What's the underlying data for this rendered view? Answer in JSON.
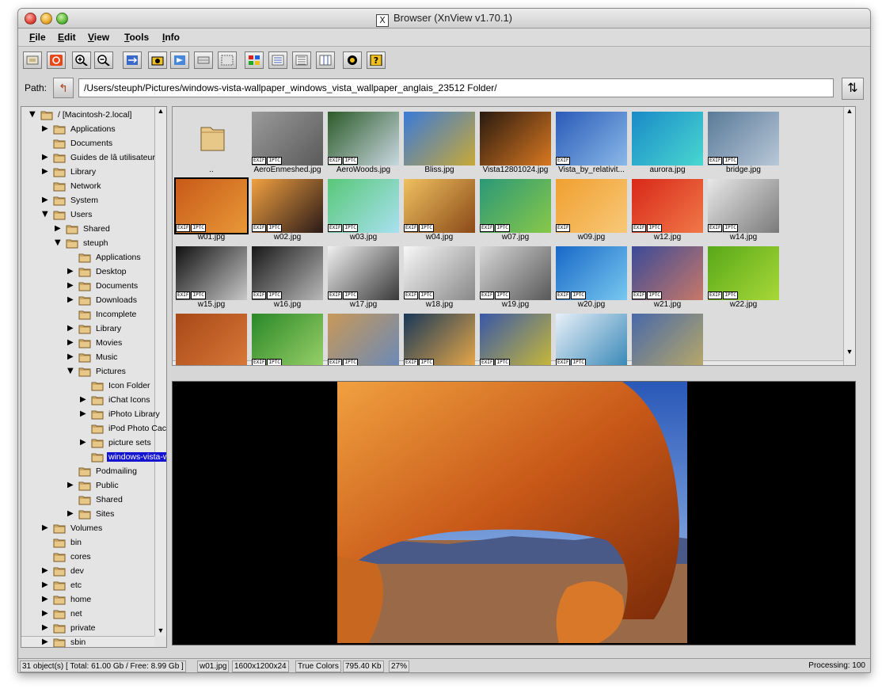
{
  "window": {
    "title": "Browser (XnView v1.70.1)"
  },
  "menu": [
    "File",
    "Edit",
    "View",
    "Tools",
    "Info"
  ],
  "path": {
    "label": "Path:",
    "value": "/Users/steuph/Pictures/windows-vista-wallpaper_windows_vista_wallpaper_anglais_23512 Folder/"
  },
  "tree": [
    {
      "label": "/ [Macintosh-2.local]",
      "depth": 0,
      "arrow": "open"
    },
    {
      "label": "Applications",
      "depth": 1,
      "arrow": "closed"
    },
    {
      "label": "Documents",
      "depth": 1,
      "arrow": "none"
    },
    {
      "label": "Guides de lâ utilisateur",
      "depth": 1,
      "arrow": "closed"
    },
    {
      "label": "Library",
      "depth": 1,
      "arrow": "closed"
    },
    {
      "label": "Network",
      "depth": 1,
      "arrow": "none"
    },
    {
      "label": "System",
      "depth": 1,
      "arrow": "closed"
    },
    {
      "label": "Users",
      "depth": 1,
      "arrow": "open"
    },
    {
      "label": "Shared",
      "depth": 2,
      "arrow": "closed"
    },
    {
      "label": "steuph",
      "depth": 2,
      "arrow": "open"
    },
    {
      "label": "Applications",
      "depth": 3,
      "arrow": "none"
    },
    {
      "label": "Desktop",
      "depth": 3,
      "arrow": "closed"
    },
    {
      "label": "Documents",
      "depth": 3,
      "arrow": "closed"
    },
    {
      "label": "Downloads",
      "depth": 3,
      "arrow": "closed"
    },
    {
      "label": "Incomplete",
      "depth": 3,
      "arrow": "none"
    },
    {
      "label": "Library",
      "depth": 3,
      "arrow": "closed"
    },
    {
      "label": "Movies",
      "depth": 3,
      "arrow": "closed"
    },
    {
      "label": "Music",
      "depth": 3,
      "arrow": "closed"
    },
    {
      "label": "Pictures",
      "depth": 3,
      "arrow": "open"
    },
    {
      "label": "Icon Folder",
      "depth": 4,
      "arrow": "none"
    },
    {
      "label": "iChat Icons",
      "depth": 4,
      "arrow": "closed"
    },
    {
      "label": "iPhoto Library",
      "depth": 4,
      "arrow": "closed"
    },
    {
      "label": "iPod Photo Cach",
      "depth": 4,
      "arrow": "none"
    },
    {
      "label": "picture sets",
      "depth": 4,
      "arrow": "closed"
    },
    {
      "label": "windows-vista-w",
      "depth": 4,
      "arrow": "none",
      "selected": true
    },
    {
      "label": "Podmailing",
      "depth": 3,
      "arrow": "none"
    },
    {
      "label": "Public",
      "depth": 3,
      "arrow": "closed"
    },
    {
      "label": "Shared",
      "depth": 3,
      "arrow": "none"
    },
    {
      "label": "Sites",
      "depth": 3,
      "arrow": "closed"
    },
    {
      "label": "Volumes",
      "depth": 1,
      "arrow": "closed"
    },
    {
      "label": "bin",
      "depth": 1,
      "arrow": "none"
    },
    {
      "label": "cores",
      "depth": 1,
      "arrow": "none"
    },
    {
      "label": "dev",
      "depth": 1,
      "arrow": "closed"
    },
    {
      "label": "etc",
      "depth": 1,
      "arrow": "closed"
    },
    {
      "label": "home",
      "depth": 1,
      "arrow": "closed"
    },
    {
      "label": "net",
      "depth": 1,
      "arrow": "closed"
    },
    {
      "label": "private",
      "depth": 1,
      "arrow": "closed"
    },
    {
      "label": "sbin",
      "depth": 1,
      "arrow": "closed"
    }
  ],
  "thumbnails": [
    {
      "name": "..",
      "kind": "folder"
    },
    {
      "name": "AeroEnmeshed.jpg",
      "colors": [
        "#9a9a9a",
        "#5a5a5a"
      ],
      "badges": [
        "EXIF",
        "IPTC"
      ]
    },
    {
      "name": "AeroWoods.jpg",
      "colors": [
        "#2d5a2a",
        "#c8d8e0"
      ],
      "badges": [
        "EXIF",
        "IPTC"
      ]
    },
    {
      "name": "Bliss.jpg",
      "colors": [
        "#3a7ad8",
        "#c8a838"
      ],
      "badges": []
    },
    {
      "name": "Vista12801024.jpg",
      "colors": [
        "#2a1a10",
        "#d87820"
      ],
      "badges": []
    },
    {
      "name": "Vista_by_relativit...",
      "colors": [
        "#2a5ab8",
        "#8ab8e8"
      ],
      "badges": [
        "EXIF"
      ]
    },
    {
      "name": "aurora.jpg",
      "colors": [
        "#1a8ac8",
        "#48d8d0"
      ],
      "badges": []
    },
    {
      "name": "bridge.jpg",
      "colors": [
        "#5a7a98",
        "#b8c8d8"
      ],
      "badges": [
        "EXIF",
        "IPTC"
      ]
    },
    {
      "name": "w01.jpg",
      "colors": [
        "#c85a18",
        "#e89838"
      ],
      "badges": [
        "EXIF",
        "IPTC"
      ],
      "selected": true
    },
    {
      "name": "w02.jpg",
      "colors": [
        "#f0a040",
        "#2a1a18"
      ],
      "badges": [
        "EXIF",
        "IPTC"
      ]
    },
    {
      "name": "w03.jpg",
      "colors": [
        "#58c878",
        "#a8e0f0"
      ],
      "badges": [
        "EXIF",
        "IPTC"
      ]
    },
    {
      "name": "w04.jpg",
      "colors": [
        "#f0c060",
        "#8a4a18"
      ],
      "badges": [
        "EXIF",
        "IPTC"
      ]
    },
    {
      "name": "w07.jpg",
      "colors": [
        "#2a9878",
        "#88c848"
      ],
      "badges": [
        "EXIF",
        "IPTC"
      ]
    },
    {
      "name": "w09.jpg",
      "colors": [
        "#f0a030",
        "#f8c878"
      ],
      "badges": [
        "EXIF"
      ]
    },
    {
      "name": "w12.jpg",
      "colors": [
        "#d82818",
        "#f07848"
      ],
      "badges": [
        "EXIF",
        "IPTC"
      ]
    },
    {
      "name": "w14.jpg",
      "colors": [
        "#e8e8e8",
        "#7a7a7a"
      ],
      "badges": [
        "EXIF",
        "IPTC"
      ]
    },
    {
      "name": "w15.jpg",
      "colors": [
        "#101010",
        "#c8c8c8"
      ],
      "badges": [
        "EXIF",
        "IPTC"
      ]
    },
    {
      "name": "w16.jpg",
      "colors": [
        "#181818",
        "#b8b8b8"
      ],
      "badges": [
        "EXIF",
        "IPTC"
      ]
    },
    {
      "name": "w17.jpg",
      "colors": [
        "#f0f0f0",
        "#383838"
      ],
      "badges": [
        "EXIF",
        "IPTC"
      ]
    },
    {
      "name": "w18.jpg",
      "colors": [
        "#f8f8f8",
        "#888888"
      ],
      "badges": [
        "EXIF",
        "IPTC"
      ]
    },
    {
      "name": "w19.jpg",
      "colors": [
        "#d8d8d8",
        "#585858"
      ],
      "badges": [
        "EXIF",
        "IPTC"
      ]
    },
    {
      "name": "w20.jpg",
      "colors": [
        "#1868c8",
        "#78c8f0"
      ],
      "badges": [
        "EXIF",
        "IPTC"
      ]
    },
    {
      "name": "w21.jpg",
      "colors": [
        "#3a4a98",
        "#c87868"
      ],
      "badges": [
        "EXIF",
        "IPTC"
      ]
    },
    {
      "name": "w22.jpg",
      "colors": [
        "#58a818",
        "#a8d838"
      ],
      "badges": [
        "EXIF",
        "IPTC"
      ]
    },
    {
      "name": "",
      "colors": [
        "#a84818",
        "#d87838"
      ],
      "badges": []
    },
    {
      "name": "",
      "colors": [
        "#2a8828",
        "#98d068"
      ],
      "badges": [
        "EXIF",
        "IPTC"
      ]
    },
    {
      "name": "",
      "colors": [
        "#c89858",
        "#6a8ab8"
      ],
      "badges": [
        "EXIF",
        "IPTC"
      ]
    },
    {
      "name": "",
      "colors": [
        "#183858",
        "#e8a848"
      ],
      "badges": [
        "EXIF",
        "IPTC"
      ]
    },
    {
      "name": "",
      "colors": [
        "#3858a8",
        "#c8b838"
      ],
      "badges": [
        "EXIF",
        "IPTC"
      ]
    },
    {
      "name": "",
      "colors": [
        "#e8f0f8",
        "#3888b8"
      ],
      "badges": [
        "EXIF",
        "IPTC"
      ]
    },
    {
      "name": "",
      "colors": [
        "#4868a8",
        "#b8a868"
      ],
      "badges": []
    }
  ],
  "status": {
    "objects": "31 object(s) [ Total: 61.00 Gb / Free: 8.99 Gb ]",
    "file": "w01.jpg",
    "size": "1600x1200x24",
    "colors": "True Colors",
    "bytes": "795.40 Kb",
    "zoom": "27%",
    "processing": "Processing: 100"
  }
}
